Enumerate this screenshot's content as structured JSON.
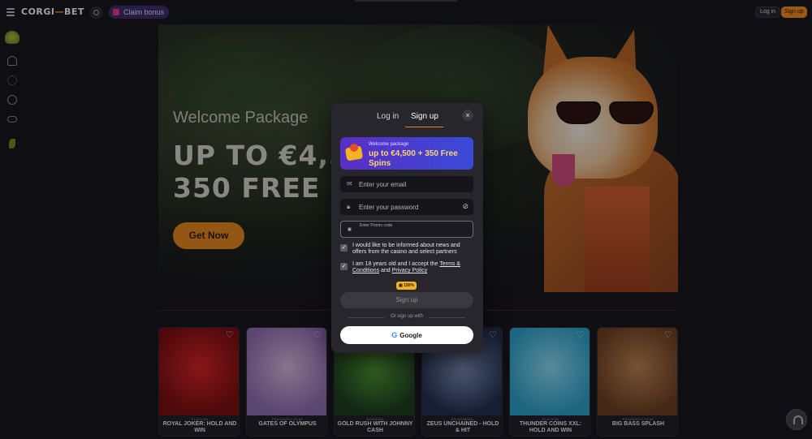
{
  "header": {
    "logo": "CORGI",
    "logo_bone": "—",
    "logo_suffix": "BET",
    "claim_bonus": "Claim bonus",
    "login": "Log in",
    "signup": "Sign up"
  },
  "sidebar": {
    "icons": [
      "sports-tree-icon",
      "strategy-icon",
      "live-signal-icon",
      "soccer-ball-icon",
      "gamepad-icon",
      "leaf-icon"
    ]
  },
  "hero": {
    "welcome": "Welcome Package",
    "line1": "UP TO €4,500 + ",
    "line2": "350 FREE SPINS",
    "cta": "Get Now"
  },
  "modal": {
    "tabs": [
      "Log in",
      "Sign up"
    ],
    "active_tab": "Sign up",
    "close_icon": "×",
    "promo_small": "Welcome package",
    "promo_big": "up to €4,500 + 350 Free Spins",
    "email_placeholder": "Enter your email",
    "password_placeholder": "Enter your password",
    "promo_label": "Enter Promo code",
    "checkbox_news": "I would like to be informed about news and offers from the casino and select partners",
    "checkbox_age_prefix": "I am 18 years old and I accept the ",
    "checkbox_terms": "Terms & Conditions",
    "checkbox_and": " and ",
    "checkbox_privacy": "Privacy Policy",
    "boost_badge": "150%",
    "signup_button": "Sign up",
    "or_text": "Or sign up with",
    "google_button": "Google"
  },
  "games": [
    {
      "provider": "PLAYSON",
      "title": "ROYAL JOKER: HOLD AND WIN",
      "colors": [
        "#7a0b0b",
        "#d81f1f"
      ]
    },
    {
      "provider": "PRAGMATIC PLAY",
      "title": "GATES OF OLYMPUS",
      "colors": [
        "#8f6bb0",
        "#d7b7d8"
      ]
    },
    {
      "provider": "BGAMING",
      "title": "GOLD RUSH WITH JOHNNY CASH",
      "colors": [
        "#1a3a1a",
        "#4e9a2e"
      ]
    },
    {
      "provider": "SPINOMENAL",
      "title": "ZEUS UNCHAINED - HOLD & HIT",
      "colors": [
        "#1e2c4a",
        "#7d8fb4"
      ]
    },
    {
      "provider": "PLAYSON",
      "title": "THUNDER COINS XXL: HOLD AND WIN",
      "colors": [
        "#2aa1c8",
        "#8ad9f0"
      ]
    },
    {
      "provider": "PRAGMATIC PLAY",
      "title": "BIG BASS SPLASH",
      "colors": [
        "#6e3d1c",
        "#b8814c"
      ]
    }
  ]
}
